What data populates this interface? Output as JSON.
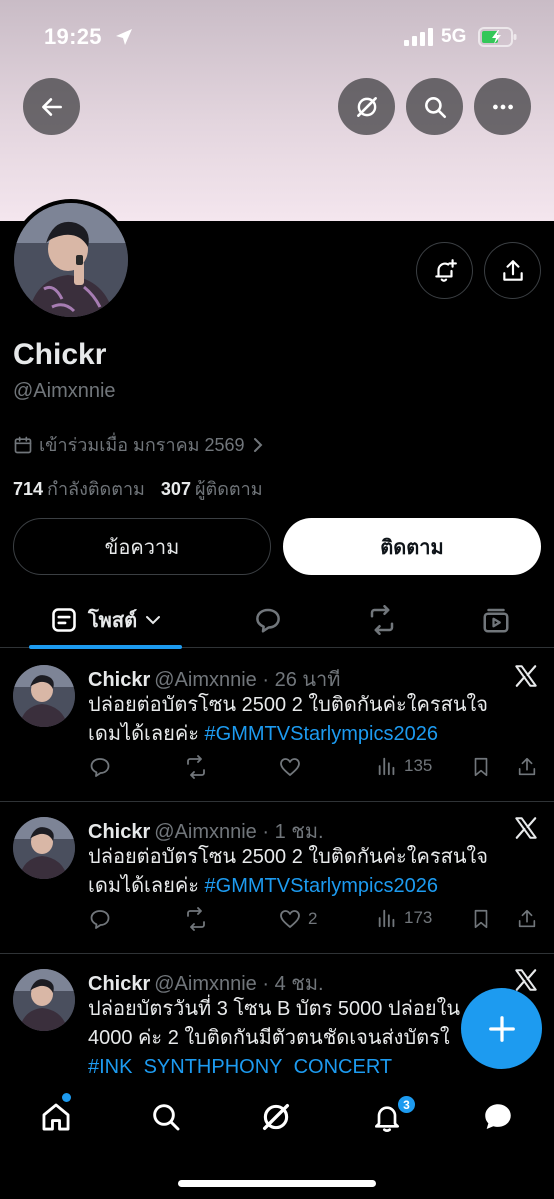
{
  "status_bar": {
    "time": "19:25",
    "network": "5G"
  },
  "profile": {
    "display_name": "Chickr",
    "handle": "@Aimxnnie",
    "joined": "เข้าร่วมเมื่อ มกราคม 2569",
    "following_count": "714",
    "following_label": "กำลังติดตาม",
    "followers_count": "307",
    "followers_label": "ผู้ติดตาม"
  },
  "buttons": {
    "message": "ข้อความ",
    "follow": "ติดตาม"
  },
  "tabs": {
    "posts_label": "โพสต์"
  },
  "posts": [
    {
      "name": "Chickr",
      "meta": "@Aimxnnie · 26 นาที",
      "line1": "ปล่อยต่อบัตรโซน 2500  2 ใบติดกันค่ะใครสนใจ",
      "line2": "เดมได้เลยค่ะ ",
      "hashtag": "#GMMTVStarlympics2026",
      "likes": "",
      "views": "135"
    },
    {
      "name": "Chickr",
      "meta": "@Aimxnnie · 1 ชม.",
      "line1": "ปล่อยต่อบัตรโซน 2500  2 ใบติดกันค่ะใครสนใจ",
      "line2": "เดมได้เลยค่ะ ",
      "hashtag": "#GMMTVStarlympics2026",
      "likes": "2",
      "views": "173"
    },
    {
      "name": "Chickr",
      "meta": "@Aimxnnie · 4 ชม.",
      "line1": "ปล่อยบัตรวันที่ 3 โซน B บัตร 5000 ปล่อยใน",
      "line2": "4000 ค่ะ 2 ใบติดกันมีตัวตนชัดเจนส่งบัตรใ",
      "hashtag": "#INK_SYNTHPHONY_CONCERT"
    }
  ],
  "bottom_nav": {
    "notifications_badge": "3"
  },
  "colors": {
    "accent": "#1d9bf0",
    "background": "#000000",
    "muted_text": "#71767b"
  }
}
